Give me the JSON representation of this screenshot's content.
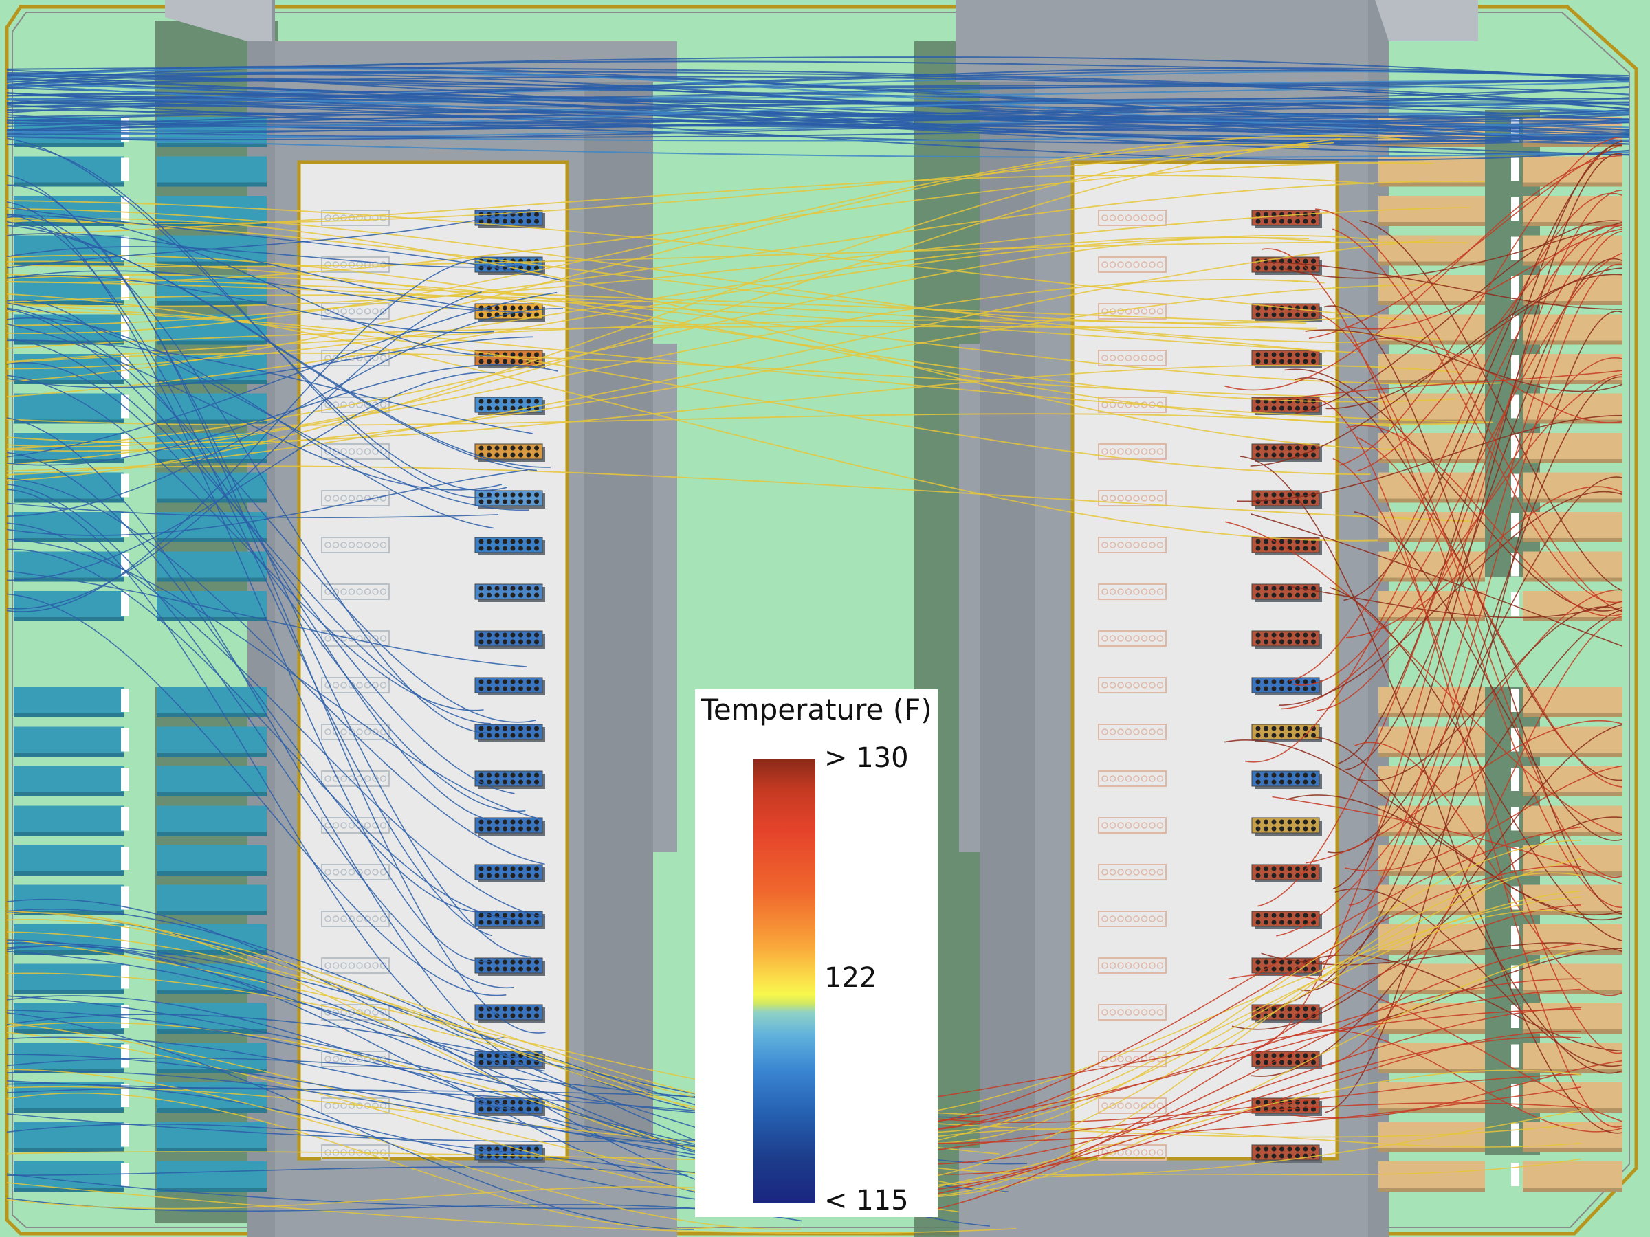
{
  "legend": {
    "title": "Temperature (F)",
    "max_label": "> 130",
    "mid_label": "122",
    "min_label": "< 115"
  },
  "colors": {
    "background": "#a6e3b6",
    "cold_blocks": "#3a9db8",
    "hot_blocks": "#dfbb83",
    "chamber_walls": "#9aa0a8",
    "shadow": "#5c7a63",
    "panel": "#e8e8e8",
    "border_gold": "#b8961e",
    "cold_stream": "#2b5ea8",
    "warm_stream": "#e6c63a",
    "hot_stream": "#c63a22"
  },
  "scene": {
    "left_rack_rows": 21,
    "right_rack_rows": 21,
    "left_cold_units": 26,
    "right_hot_units": 26
  }
}
